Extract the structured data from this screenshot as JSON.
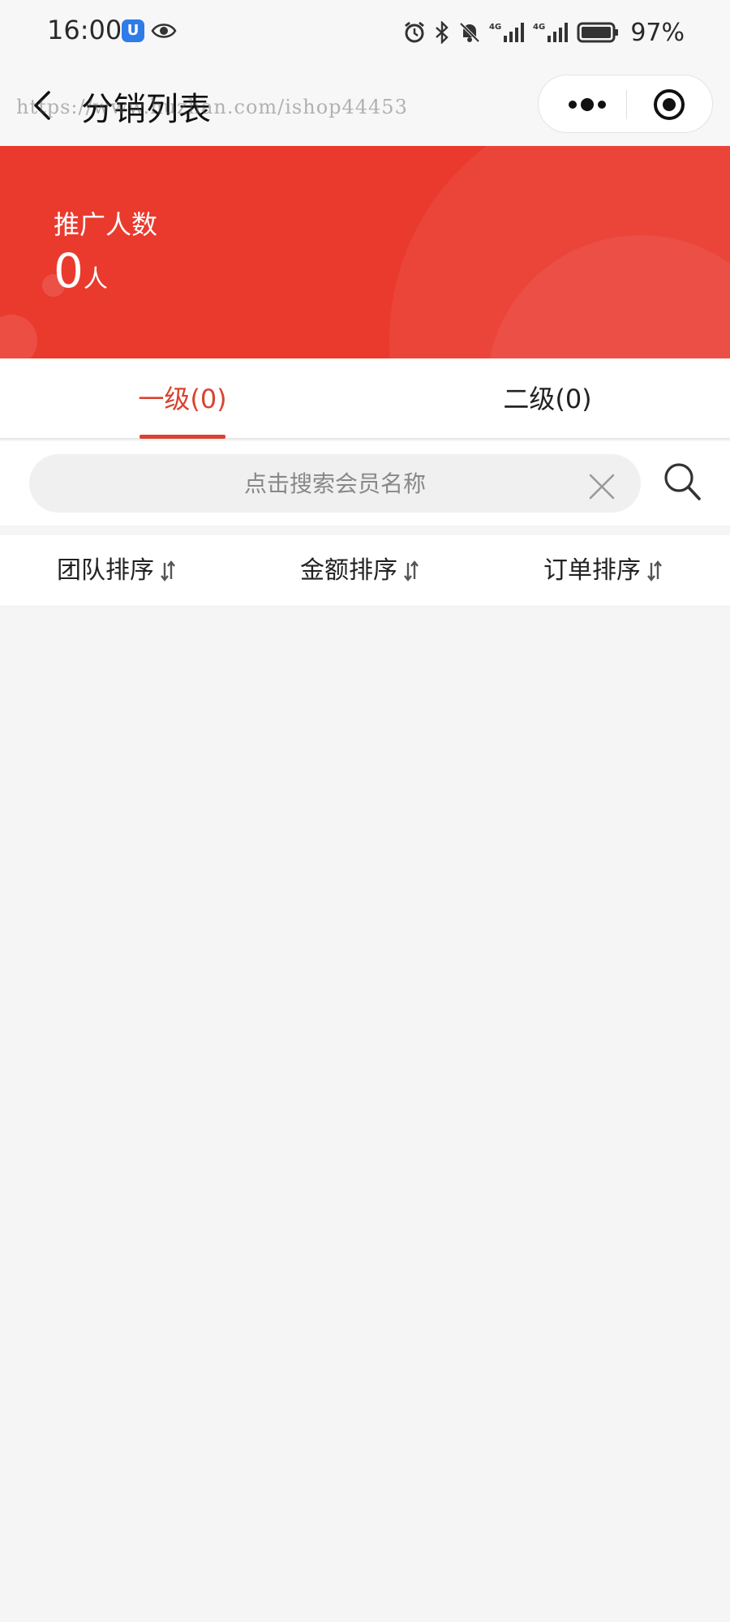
{
  "status_bar": {
    "time": "16:00",
    "battery_percent": "97%",
    "icons": [
      "app-shield-icon",
      "eye-icon",
      "alarm-icon",
      "bluetooth-icon",
      "mute-icon",
      "signal-4g-icon",
      "signal-4g-icon",
      "battery-icon"
    ]
  },
  "nav": {
    "title": "分销列表",
    "watermark": "https://www.huzhan.com/ishop44453"
  },
  "banner": {
    "label": "推广人数",
    "count": "0",
    "unit": "人",
    "color": "#ea3a2e"
  },
  "tabs": [
    {
      "label": "一级(0)",
      "active": true
    },
    {
      "label": "二级(0)",
      "active": false
    }
  ],
  "search": {
    "placeholder": "点击搜索会员名称",
    "value": ""
  },
  "sort": {
    "team": "团队排序",
    "amount": "金额排序",
    "order": "订单排序"
  },
  "colors": {
    "accent": "#d9432f",
    "background": "#f5f5f5"
  }
}
